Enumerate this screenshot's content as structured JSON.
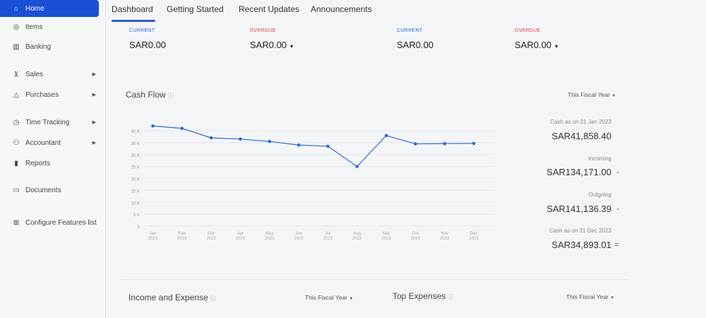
{
  "sidebar": {
    "items": [
      {
        "label": "Home",
        "icon": "home-icon",
        "glyph": "⌂"
      },
      {
        "label": "Items",
        "icon": "items-icon",
        "glyph": "◎"
      },
      {
        "label": "Banking",
        "icon": "bank-icon",
        "glyph": "🏦"
      },
      {
        "label": "Sales",
        "icon": "cart-icon",
        "glyph": "🛒"
      },
      {
        "label": "Purchases",
        "icon": "bag-icon",
        "glyph": "⌂"
      },
      {
        "label": "Time Tracking",
        "icon": "clock-icon",
        "glyph": "◷"
      },
      {
        "label": "Accountant",
        "icon": "accountant-icon",
        "glyph": "⚇"
      },
      {
        "label": "Reports",
        "icon": "reports-icon",
        "glyph": "▮"
      },
      {
        "label": "Documents",
        "icon": "documents-icon",
        "glyph": "▭"
      },
      {
        "label": "Configure Features list",
        "icon": "grid-icon",
        "glyph": "⊞"
      }
    ]
  },
  "tabs": [
    "Dashboard",
    "Getting Started",
    "Recent Updates",
    "Announcements"
  ],
  "summary": [
    {
      "label": "CURRENT",
      "value": "SAR0.00",
      "color": "#2b6cd8"
    },
    {
      "label": "OVERDUE",
      "value": "SAR0.00",
      "color": "#d64545"
    },
    {
      "label": "CURRENT",
      "value": "SAR0.00",
      "color": "#2b6cd8"
    },
    {
      "label": "OVERDUE",
      "value": "SAR0.00",
      "color": "#d64545"
    }
  ],
  "cash_flow": {
    "title": "Cash Flow",
    "period": "This Fiscal Year",
    "opening_label": "Cash as on 01 Jan 2023",
    "opening_value": "SAR41,858.40",
    "incoming_label": "Incoming",
    "incoming_value": "SAR134,171.00",
    "incoming_suffix": "-",
    "outgoing_label": "Outgoing",
    "outgoing_value": "SAR141,136.39",
    "outgoing_suffix": "-",
    "closing_label": "Cash as on 31 Dec 2023",
    "closing_value": "SAR34,893.01",
    "closing_suffix": "="
  },
  "chart_data": {
    "type": "line",
    "x": [
      "Jan 2023",
      "Feb 2023",
      "Mar 2023",
      "Apr 2023",
      "May 2023",
      "Jun 2023",
      "Jul 2023",
      "Aug 2023",
      "Sep 2023",
      "Oct 2023",
      "Nov 2023",
      "Dec 2023"
    ],
    "values": [
      42000,
      41000,
      37000,
      36500,
      35500,
      34000,
      33500,
      25000,
      38000,
      34500,
      34600,
      34700
    ],
    "yticks": [
      "40 K",
      "35 K",
      "30 K",
      "25 K",
      "20 K",
      "15 K",
      "10 K",
      "5 K",
      "0"
    ],
    "ylim": [
      0,
      40000
    ],
    "grid": true,
    "color": "#2b6cd8"
  },
  "bottom": {
    "income_title": "Income and Expense",
    "income_period": "This Fiscal Year",
    "expenses_title": "Top Expenses",
    "expenses_period": "This Fiscal Year"
  }
}
